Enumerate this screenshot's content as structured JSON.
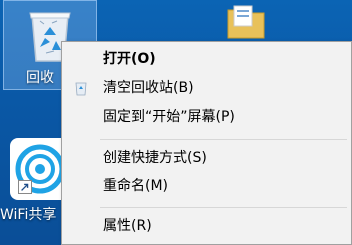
{
  "desktop": {
    "recycle_bin_label": "回收",
    "wifi_label": "WiFi共享"
  },
  "context_menu": {
    "items": [
      {
        "label": "打开(O)",
        "bold": true
      },
      {
        "label": "清空回收站(B)",
        "icon": "recycle-bin-icon"
      },
      {
        "label": "固定到“开始”屏幕(P)"
      },
      {
        "label": "创建快捷方式(S)"
      },
      {
        "label": "重命名(M)"
      },
      {
        "label": "属性(R)"
      }
    ]
  },
  "colors": {
    "desktop_background": "#0a5aa4",
    "menu_background": "#f2f2f2",
    "selection_highlight": "#8cbef0"
  }
}
